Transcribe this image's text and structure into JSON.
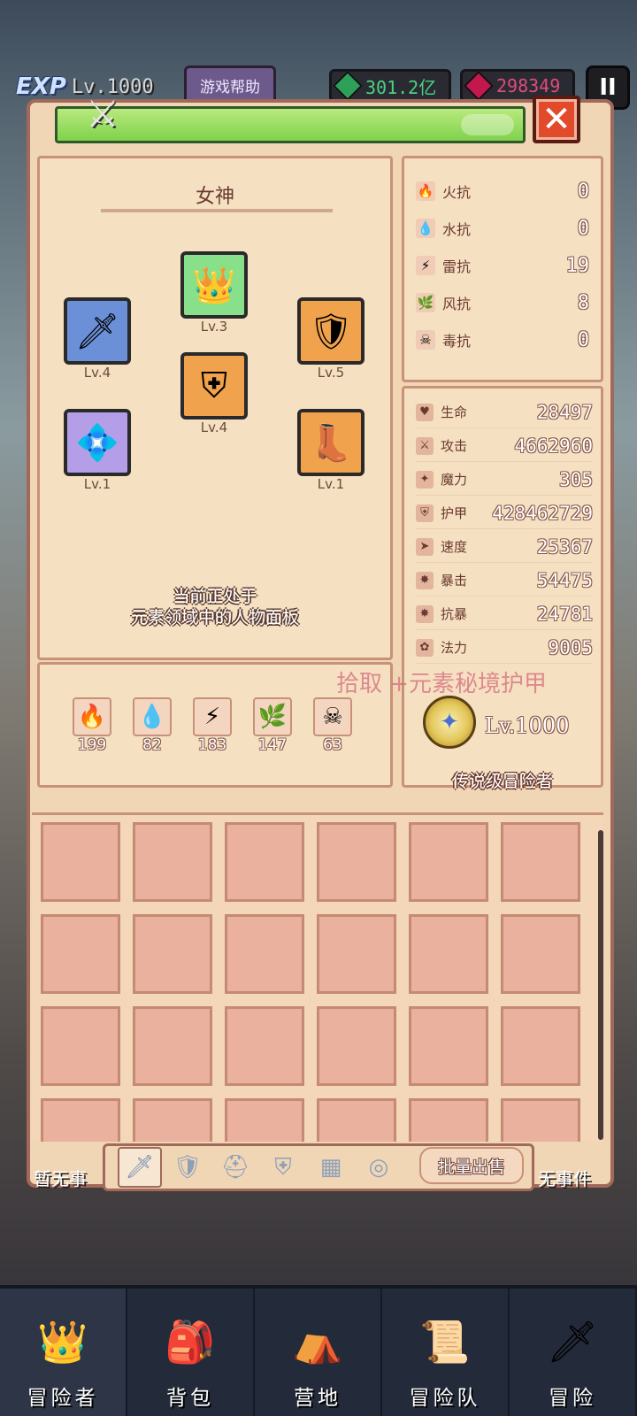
{
  "hud": {
    "exp_badge": "EXP",
    "level": "Lv.1000",
    "help_button": "游戏帮助",
    "emerald": "301.2亿",
    "ruby": "298349",
    "pause": "II"
  },
  "panel": {
    "character_name": "女神",
    "status_message_line1": "当前正处于",
    "status_message_line2": "元素领域中的人物面板"
  },
  "equipment": [
    {
      "slot": "sword",
      "level": "Lv.4",
      "icon": "sword-icon",
      "glyph": "🗡",
      "rarity": "blue"
    },
    {
      "slot": "helmet",
      "level": "Lv.3",
      "icon": "helmet-icon",
      "glyph": "👑",
      "rarity": "green"
    },
    {
      "slot": "shield",
      "level": "Lv.5",
      "icon": "shield-icon",
      "glyph": "🛡",
      "rarity": "orange"
    },
    {
      "slot": "armor",
      "level": "Lv.4",
      "icon": "armor-icon",
      "glyph": "⛨",
      "rarity": "orange"
    },
    {
      "slot": "amulet",
      "level": "Lv.1",
      "icon": "amulet-icon",
      "glyph": "💠",
      "rarity": "purple"
    },
    {
      "slot": "boots",
      "level": "Lv.1",
      "icon": "boots-icon",
      "glyph": "👢",
      "rarity": "orange"
    }
  ],
  "elements": [
    {
      "name": "fire",
      "icon": "fire-icon",
      "glyph": "🔥",
      "value": "199"
    },
    {
      "name": "water",
      "icon": "water-icon",
      "glyph": "💧",
      "value": "82"
    },
    {
      "name": "thunder",
      "icon": "thunder-icon",
      "glyph": "⚡",
      "value": "183"
    },
    {
      "name": "wind",
      "icon": "wind-icon",
      "glyph": "🌿",
      "value": "147"
    },
    {
      "name": "poison",
      "icon": "poison-icon",
      "glyph": "☠",
      "value": "63"
    }
  ],
  "resistances": [
    {
      "label": "火抗",
      "value": "0",
      "icon": "fire-resist-icon",
      "glyph": "🔥"
    },
    {
      "label": "水抗",
      "value": "0",
      "icon": "water-resist-icon",
      "glyph": "💧"
    },
    {
      "label": "雷抗",
      "value": "19",
      "icon": "thunder-resist-icon",
      "glyph": "⚡"
    },
    {
      "label": "风抗",
      "value": "8",
      "icon": "wind-resist-icon",
      "glyph": "🌿"
    },
    {
      "label": "毒抗",
      "value": "0",
      "icon": "poison-resist-icon",
      "glyph": "☠"
    }
  ],
  "stats": [
    {
      "label": "生命",
      "value": "28497",
      "icon": "heart-icon",
      "glyph": "♥"
    },
    {
      "label": "攻击",
      "value": "4662960",
      "icon": "attack-icon",
      "glyph": "⚔"
    },
    {
      "label": "魔力",
      "value": "305",
      "icon": "magic-icon",
      "glyph": "✦"
    },
    {
      "label": "护甲",
      "value": "428462729",
      "icon": "armor-stat-icon",
      "glyph": "⛨"
    },
    {
      "label": "速度",
      "value": "25367",
      "icon": "speed-icon",
      "glyph": "➤"
    },
    {
      "label": "暴击",
      "value": "54475",
      "icon": "crit-icon",
      "glyph": "✸"
    },
    {
      "label": "抗暴",
      "value": "24781",
      "icon": "crit-resist-icon",
      "glyph": "✸"
    },
    {
      "label": "法力",
      "value": "9005",
      "icon": "mana-icon",
      "glyph": "✿"
    }
  ],
  "pickup_text": "拾取 +元素秘境护甲",
  "rank": {
    "level": "Lv.1000",
    "title": "传说级冒险者"
  },
  "tabs": {
    "bulk_sell": "批量出售",
    "items": [
      {
        "icon": "tab-weapon-icon",
        "glyph": "🗡",
        "active": true
      },
      {
        "icon": "tab-shield-icon",
        "glyph": "🛡",
        "active": false
      },
      {
        "icon": "tab-helmet-icon",
        "glyph": "⛑",
        "active": false
      },
      {
        "icon": "tab-armor-icon",
        "glyph": "⛨",
        "active": false
      },
      {
        "icon": "tab-boots-icon",
        "glyph": "▦",
        "active": false
      },
      {
        "icon": "tab-ring-icon",
        "glyph": "◎",
        "active": false
      }
    ]
  },
  "events": {
    "left": "暂无事",
    "right": "无事件"
  },
  "nav": [
    {
      "label": "冒险者",
      "icon": "adventurer-icon",
      "glyph": "👑",
      "active": true
    },
    {
      "label": "背包",
      "icon": "backpack-icon",
      "glyph": "🎒",
      "active": false
    },
    {
      "label": "营地",
      "icon": "camp-icon",
      "glyph": "⛺",
      "active": false
    },
    {
      "label": "冒险队",
      "icon": "team-icon",
      "glyph": "📜",
      "active": false
    },
    {
      "label": "冒险",
      "icon": "adventure-icon",
      "glyph": "🗡",
      "active": false
    }
  ],
  "colors": {
    "panel": "#f1d6b6",
    "title_bar": "#7fd24c",
    "close_button": "#e24a2c",
    "emerald": "#4cd280",
    "ruby": "#e04c7c"
  }
}
